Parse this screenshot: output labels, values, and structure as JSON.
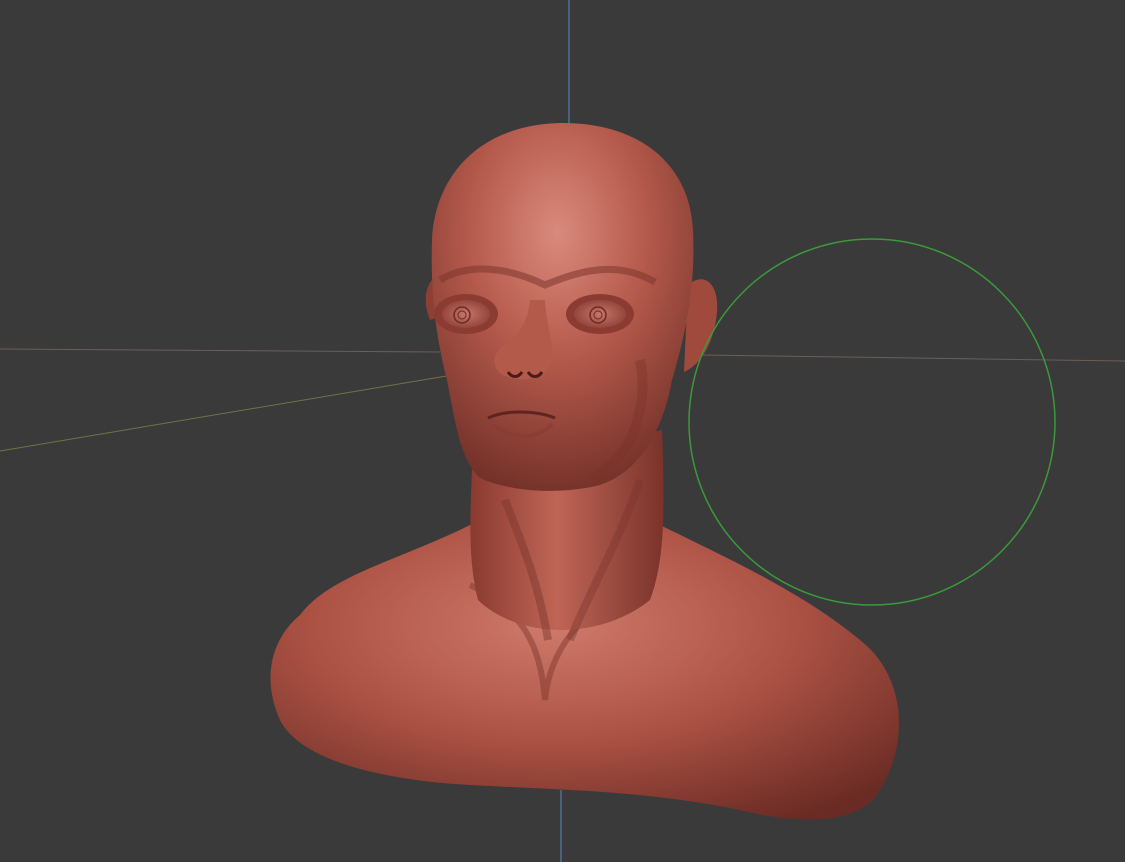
{
  "viewport": {
    "background_color": "#3a3a3a",
    "axes": {
      "z_axis_color": "#5a86c8",
      "x_axis_color": "#6a5f59",
      "y_axis_color": "#6e7446"
    },
    "brush_cursor_color": "#3a9a3a",
    "model": {
      "type": "sculpt-bust",
      "material_color": "#b85a4c",
      "highlight_color": "#d98878",
      "shadow_color": "#6e2e26"
    }
  }
}
